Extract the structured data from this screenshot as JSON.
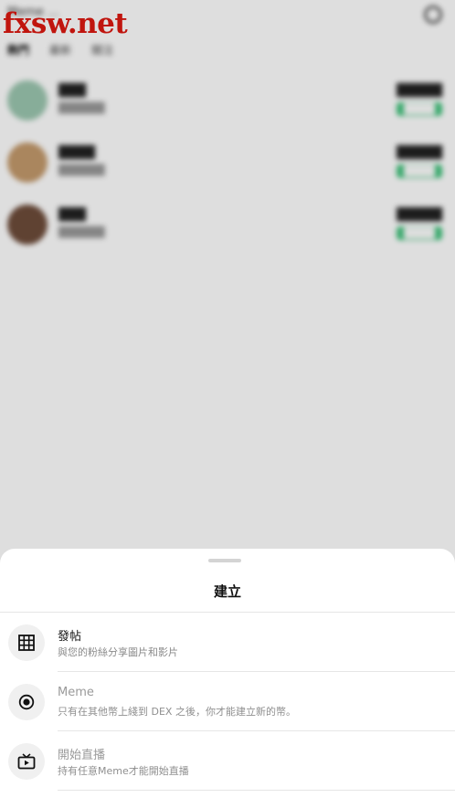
{
  "watermark": {
    "text": "fxsw.net",
    "color": "#c0150e"
  },
  "background": {
    "title": "Meme …",
    "search_icon": "search-icon",
    "tabs": [
      "熱門",
      "最新",
      "關注"
    ],
    "rows": [
      {
        "name": "███",
        "sub": "██████",
        "price": "█████",
        "change": "████"
      },
      {
        "name": "████",
        "sub": "██████",
        "price": "█████",
        "change": "████"
      },
      {
        "name": "███",
        "sub": "██████",
        "price": "█████",
        "change": "████"
      }
    ],
    "accent_color": "#3ec17a"
  },
  "sheet": {
    "title": "建立",
    "options": [
      {
        "icon": "grid-icon",
        "title": "發帖",
        "description": "與您的粉絲分享圖片和影片",
        "enabled": true
      },
      {
        "icon": "target-circle-icon",
        "title": "Meme",
        "description": "只有在其他幣上綫到 DEX 之後，你才能建立新的幣。",
        "enabled": false
      },
      {
        "icon": "live-tv-icon",
        "title": "開始直播",
        "description": "持有任意Meme才能開始直播",
        "enabled": false
      }
    ]
  }
}
